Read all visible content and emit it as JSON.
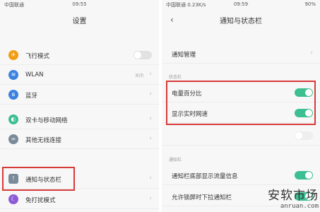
{
  "colors": {
    "highlight": "#d83a3a",
    "toggle_on": "#3cbf91",
    "toggle_off": "#e2e2e2"
  },
  "left": {
    "status": {
      "carrier": "中国联通",
      "time": "09:55",
      "right": ""
    },
    "title": "设置",
    "items": [
      {
        "label": "飞行模式",
        "icon": "airplane-icon",
        "icon_color": "#f39c12",
        "control": "toggle-off"
      },
      {
        "label": "WLAN",
        "icon": "wifi-icon",
        "icon_color": "#3b82e0",
        "value": "关闭",
        "control": "chevron"
      },
      {
        "label": "蓝牙",
        "icon": "bluetooth-icon",
        "icon_color": "#3b82e0",
        "control": "chevron"
      },
      {
        "label": "双卡与移动网络",
        "icon": "sim-icon",
        "icon_color": "#3cbf91",
        "control": "chevron"
      },
      {
        "label": "其他无线连接",
        "icon": "link-icon",
        "icon_color": "#7a8a99",
        "control": "chevron"
      },
      {
        "label": "通知与状态栏",
        "icon": "notification-icon",
        "icon_color": "#7a8a99",
        "control": "chevron"
      },
      {
        "label": "免打扰模式",
        "icon": "moon-icon",
        "icon_color": "#8e5bd6",
        "control": "chevron"
      }
    ]
  },
  "right": {
    "status": {
      "carrier": "中国联通 0.23K/s",
      "time": "09:59",
      "right": "90%"
    },
    "title": "通知与状态栏",
    "top_item": {
      "label": "通知管理"
    },
    "section1": "状态栏",
    "items1": [
      {
        "label": "电量百分比",
        "on": true
      },
      {
        "label": "显示实时网速",
        "on": true
      },
      {
        "label": "",
        "on": false
      }
    ],
    "section2": "通知栏",
    "items2": [
      {
        "label": "通知栏底部显示流量信息",
        "on": true
      },
      {
        "label": "允许锁屏时下拉通知栏",
        "on": true
      }
    ]
  },
  "watermark": {
    "cn": "安软市场",
    "en": "anruan.com"
  }
}
